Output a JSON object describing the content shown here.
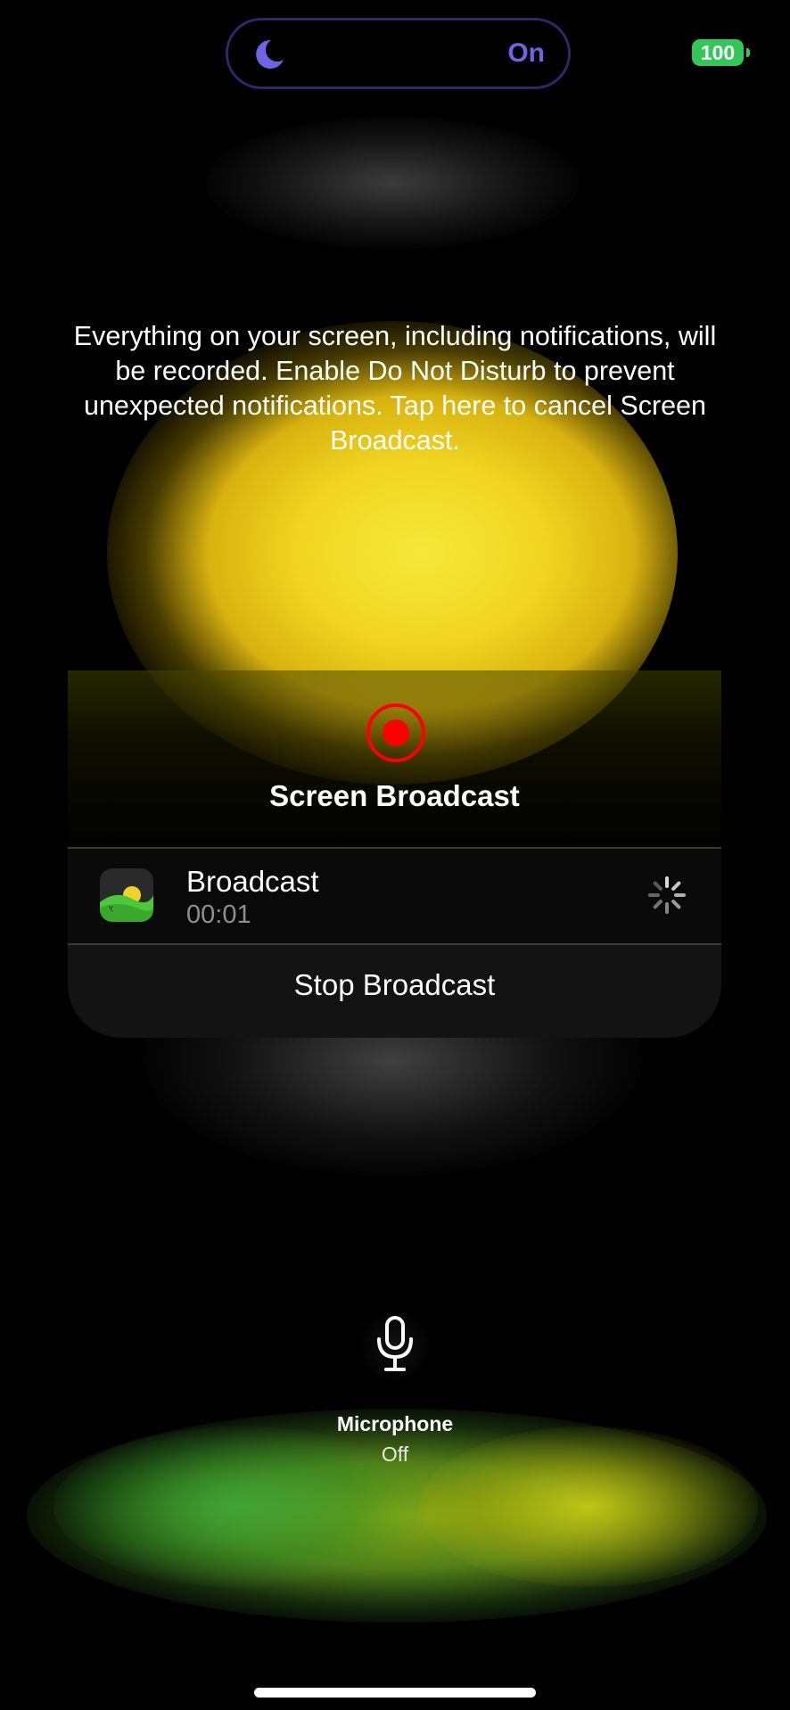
{
  "status_bar": {
    "focus_mode": {
      "icon": "moon-icon",
      "status": "On",
      "accent_color": "#6e65e6"
    },
    "battery": {
      "level": "100",
      "color": "#32c759"
    }
  },
  "notice": {
    "text": "Everything on your screen, including notifications, will be recorded. Enable Do Not Disturb to prevent unexpected notifications. Tap here to cancel Screen Broadcast."
  },
  "broadcast_card": {
    "icon": "record-icon",
    "record_color": "#ff0000",
    "title": "Screen Broadcast",
    "app_row": {
      "app_icon": "photo-app-icon",
      "title": "Broadcast",
      "elapsed": "00:01",
      "status_icon": "spinner-icon"
    },
    "stop_label": "Stop Broadcast"
  },
  "microphone": {
    "icon": "microphone-icon",
    "label": "Microphone",
    "state": "Off"
  }
}
